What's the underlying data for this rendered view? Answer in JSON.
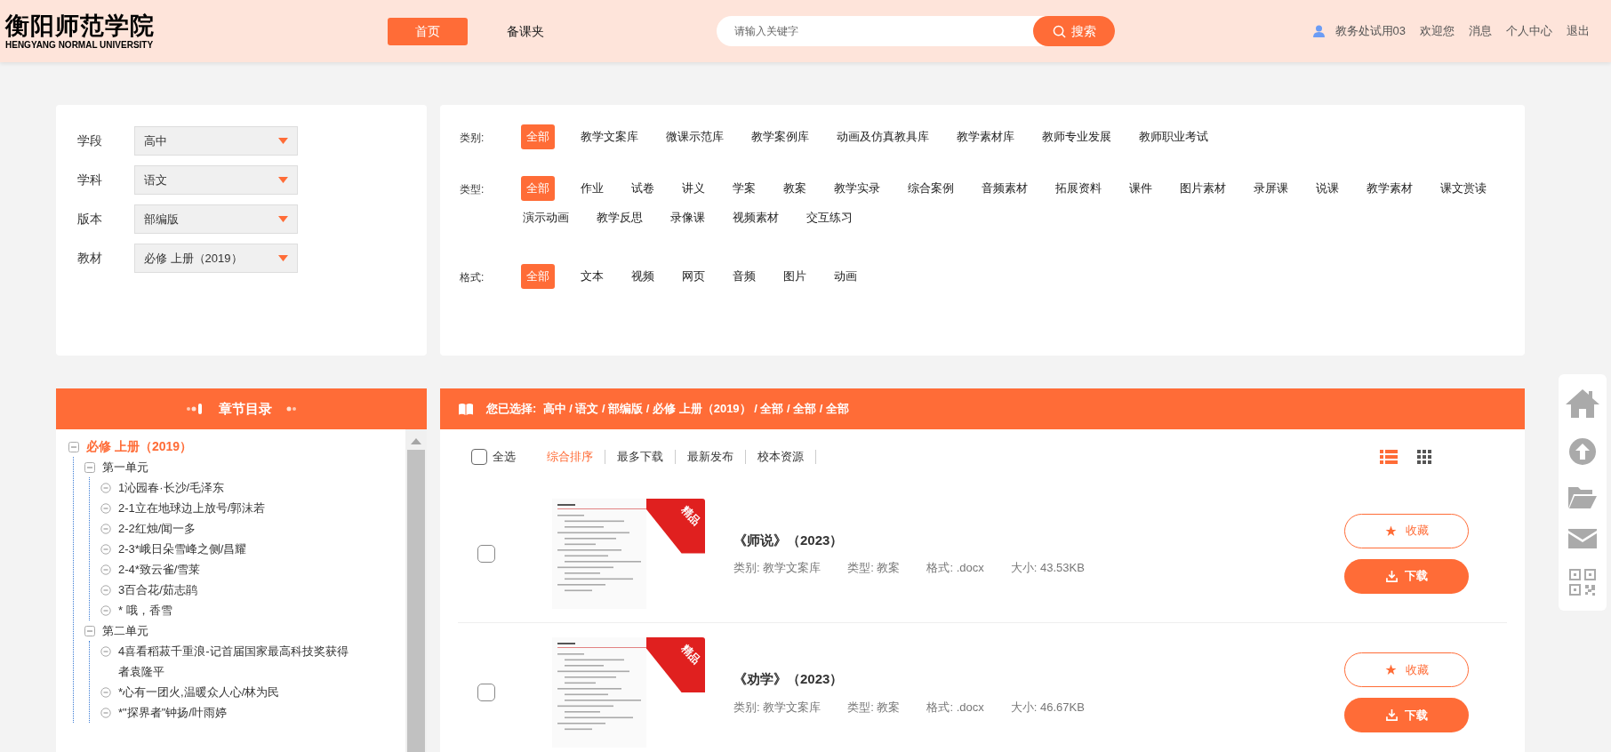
{
  "header": {
    "logo_cn": "衡阳师范学院",
    "logo_en": "HENGYANG NORMAL UNIVERSITY",
    "nav": [
      {
        "label": "首页",
        "selected": true
      },
      {
        "label": "备课夹",
        "selected": false
      }
    ],
    "search": {
      "placeholder": "请输入关键字",
      "button": "搜索"
    },
    "user": [
      {
        "kind": "user",
        "label": "教务处试用03"
      },
      {
        "kind": "link",
        "label": "欢迎您"
      },
      {
        "kind": "link",
        "label": "消息"
      },
      {
        "kind": "link",
        "label": "个人中心"
      },
      {
        "kind": "link",
        "label": "退出"
      }
    ]
  },
  "selectors": [
    {
      "label": "学段",
      "value": "高中"
    },
    {
      "label": "学科",
      "value": "语文"
    },
    {
      "label": "版本",
      "value": "部编版"
    },
    {
      "label": "教材",
      "value": "必修 上册（2019）"
    }
  ],
  "filters": [
    {
      "label": "类别:",
      "options": [
        {
          "label": "全部",
          "selected": true
        },
        {
          "label": "教学文案库",
          "selected": false
        },
        {
          "label": "微课示范库",
          "selected": false
        },
        {
          "label": "教学案例库",
          "selected": false
        },
        {
          "label": "动画及仿真教具库",
          "selected": false
        },
        {
          "label": "教学素材库",
          "selected": false
        },
        {
          "label": "教师专业发展",
          "selected": false
        },
        {
          "label": "教师职业考试",
          "selected": false
        }
      ]
    },
    {
      "label": "类型:",
      "options": [
        {
          "label": "全部",
          "selected": true
        },
        {
          "label": "作业",
          "selected": false
        },
        {
          "label": "试卷",
          "selected": false
        },
        {
          "label": "讲义",
          "selected": false
        },
        {
          "label": "学案",
          "selected": false
        },
        {
          "label": "教案",
          "selected": false
        },
        {
          "label": "教学实录",
          "selected": false
        },
        {
          "label": "综合案例",
          "selected": false
        },
        {
          "label": "音频素材",
          "selected": false
        },
        {
          "label": "拓展资料",
          "selected": false
        },
        {
          "label": "课件",
          "selected": false
        },
        {
          "label": "图片素材",
          "selected": false
        },
        {
          "label": "录屏课",
          "selected": false
        },
        {
          "label": "说课",
          "selected": false
        },
        {
          "label": "教学素材",
          "selected": false
        },
        {
          "label": "课文赏读",
          "selected": false
        },
        {
          "label": "演示动画",
          "selected": false
        },
        {
          "label": "教学反思",
          "selected": false
        },
        {
          "label": "录像课",
          "selected": false
        },
        {
          "label": "视频素材",
          "selected": false
        },
        {
          "label": "交互练习",
          "selected": false
        }
      ]
    },
    {
      "label": "格式:",
      "options": [
        {
          "label": "全部",
          "selected": true
        },
        {
          "label": "文本",
          "selected": false
        },
        {
          "label": "视频",
          "selected": false
        },
        {
          "label": "网页",
          "selected": false
        },
        {
          "label": "音频",
          "selected": false
        },
        {
          "label": "图片",
          "selected": false
        },
        {
          "label": "动画",
          "selected": false
        }
      ]
    }
  ],
  "tree": {
    "title": "章节目录",
    "nodes": [
      {
        "label": "必修 上册（2019）",
        "expanded": true,
        "children": [
          {
            "label": "第一单元",
            "expanded": true,
            "children": [
              {
                "label": "1沁园春·长沙/毛泽东"
              },
              {
                "label": "2-1立在地球边上放号/郭沫若"
              },
              {
                "label": "2-2红烛/闻一多"
              },
              {
                "label": "2-3*峨日朵雪峰之侧/昌耀"
              },
              {
                "label": "2-4*致云雀/雪莱"
              },
              {
                "label": "3百合花/茹志鹃"
              },
              {
                "label": "* 哦，香雪"
              }
            ]
          },
          {
            "label": "第二单元",
            "expanded": true,
            "children": [
              {
                "label": "4喜看稻菽千重浪-记首届国家最高科技奖获得者袁隆平"
              },
              {
                "label": "*心有一团火,温暖众人心/林为民"
              },
              {
                "label": "*\"探界者\"钟扬/叶雨婷"
              }
            ]
          }
        ]
      }
    ]
  },
  "results": {
    "prefix": "您已选择:",
    "path": "高中 / 语文 / 部编版 / 必修 上册（2019） / 全部 / 全部 / 全部",
    "select_all": {
      "label": "全选",
      "checked": false
    },
    "sorts": [
      {
        "label": "综合排序",
        "selected": true
      },
      {
        "label": "最多下载",
        "selected": false
      },
      {
        "label": "最新发布",
        "selected": false
      },
      {
        "label": "校本资源",
        "selected": false
      }
    ],
    "views": [
      {
        "kind": "list",
        "selected": true
      },
      {
        "kind": "grid",
        "selected": false
      }
    ],
    "items": [
      {
        "title": "《师说》（2023）",
        "badge": "精品",
        "checked": false,
        "meta": [
          "类别: 教学文案库",
          "类型: 教案",
          "格式: .docx",
          "大小: 43.53KB"
        ],
        "actions": [
          {
            "kind": "favorite",
            "label": "收藏"
          },
          {
            "kind": "download",
            "label": "下载"
          }
        ]
      },
      {
        "title": "《劝学》（2023）",
        "badge": "精品",
        "checked": false,
        "meta": [
          "类别: 教学文案库",
          "类型: 教案",
          "格式: .docx",
          "大小: 46.67KB"
        ],
        "actions": [
          {
            "kind": "favorite",
            "label": "收藏"
          },
          {
            "kind": "download",
            "label": "下载"
          }
        ]
      }
    ]
  }
}
